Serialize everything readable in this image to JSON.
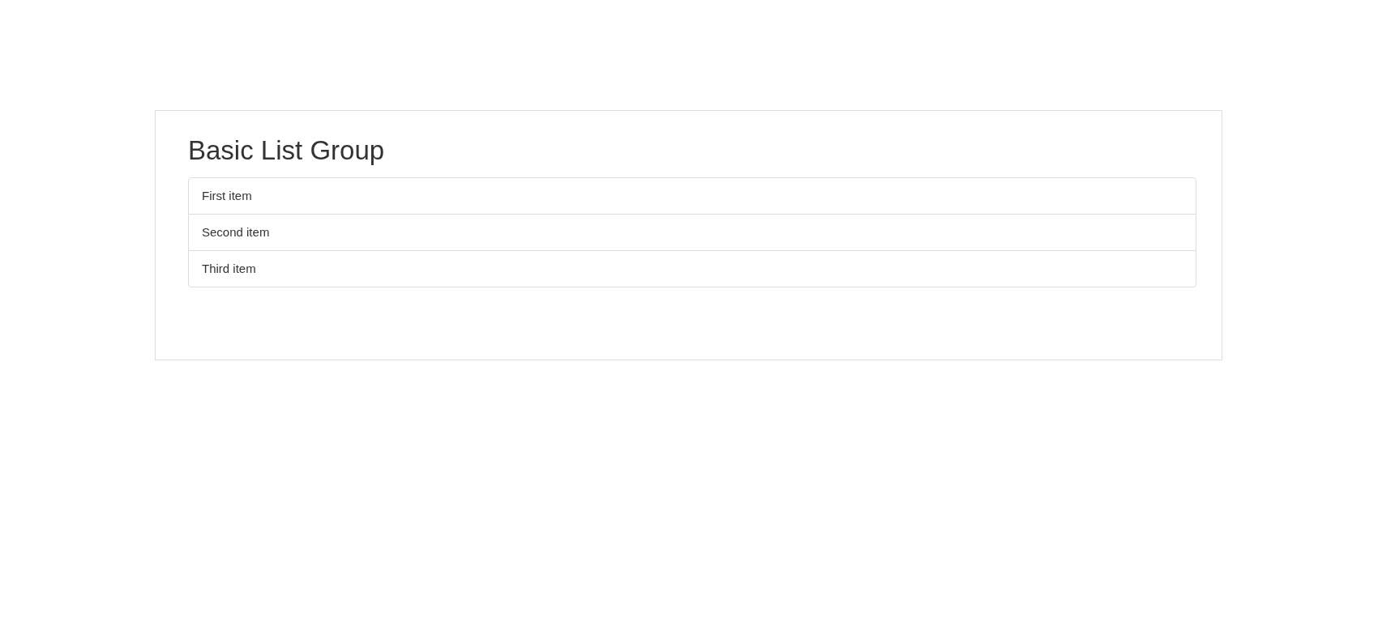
{
  "heading": "Basic List Group",
  "list_items": [
    {
      "label": "First item"
    },
    {
      "label": "Second item"
    },
    {
      "label": "Third item"
    }
  ]
}
